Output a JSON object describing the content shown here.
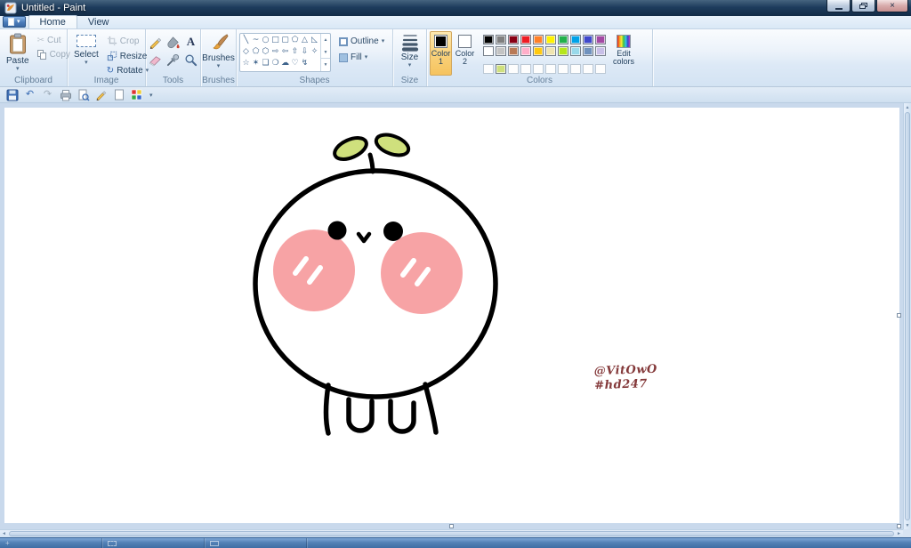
{
  "window": {
    "title": "Untitled - Paint"
  },
  "icons": {
    "dropdown": "▾",
    "scroll_up": "▲",
    "scroll_down": "▼",
    "close": "×",
    "cut": "✂",
    "undo": "↶",
    "redo": "↷",
    "rotate": "↻",
    "text_tool": "A",
    "customize": "▾",
    "scroll_left": "◄",
    "scroll_right": "►",
    "crosshair": "+"
  },
  "ribbon": {
    "tabs": [
      {
        "id": "home",
        "label": "Home",
        "active": true
      },
      {
        "id": "view",
        "label": "View",
        "active": false
      }
    ],
    "clipboard": {
      "group_label": "Clipboard",
      "paste": "Paste",
      "cut": "Cut",
      "copy": "Copy"
    },
    "image": {
      "group_label": "Image",
      "select": "Select",
      "crop": "Crop",
      "resize": "Resize",
      "rotate": "Rotate"
    },
    "tools": {
      "group_label": "Tools",
      "items": [
        "pencil",
        "fill-with-color",
        "text",
        "eraser",
        "color-picker",
        "magnifier"
      ]
    },
    "brushes": {
      "group_label": "Brushes",
      "label": "Brushes"
    },
    "shapes": {
      "group_label": "Shapes",
      "outline_label": "Outline",
      "fill_label": "Fill",
      "items": [
        {
          "name": "line",
          "glyph": "╲"
        },
        {
          "name": "curve",
          "glyph": "~"
        },
        {
          "name": "oval",
          "glyph": "○"
        },
        {
          "name": "rectangle",
          "glyph": "□"
        },
        {
          "name": "rounded-rectangle",
          "glyph": "▢"
        },
        {
          "name": "polygon",
          "glyph": "⬠"
        },
        {
          "name": "triangle",
          "glyph": "△"
        },
        {
          "name": "right-triangle",
          "glyph": "◺"
        },
        {
          "name": "diamond",
          "glyph": "◇"
        },
        {
          "name": "pentagon",
          "glyph": "⬠"
        },
        {
          "name": "hexagon",
          "glyph": "⬡"
        },
        {
          "name": "right-arrow",
          "glyph": "⇨"
        },
        {
          "name": "left-arrow",
          "glyph": "⇦"
        },
        {
          "name": "up-arrow",
          "glyph": "⇧"
        },
        {
          "name": "down-arrow",
          "glyph": "⇩"
        },
        {
          "name": "four-point-star",
          "glyph": "✧"
        },
        {
          "name": "five-point-star",
          "glyph": "☆"
        },
        {
          "name": "six-point-star",
          "glyph": "✶"
        },
        {
          "name": "rounded-callout",
          "glyph": "❑"
        },
        {
          "name": "oval-callout",
          "glyph": "❍"
        },
        {
          "name": "cloud-callout",
          "glyph": "☁"
        },
        {
          "name": "heart",
          "glyph": "♡"
        },
        {
          "name": "lightning",
          "glyph": "↯"
        }
      ]
    },
    "size": {
      "group_label": "Size",
      "label": "Size"
    },
    "colors": {
      "group_label": "Colors",
      "color1_label": "Color",
      "color1_num": "1",
      "color1_value": "#000000",
      "color2_label": "Color",
      "color2_num": "2",
      "color2_value": "#ffffff",
      "edit_line1": "Edit",
      "edit_line2": "colors",
      "palette_rows": [
        [
          "#000000",
          "#7f7f7f",
          "#880015",
          "#ed1c24",
          "#ff7f27",
          "#fff200",
          "#22b14c",
          "#00a2e8",
          "#3f48cc",
          "#a349a4"
        ],
        [
          "#ffffff",
          "#c3c3c3",
          "#b97a57",
          "#ffaec9",
          "#ffc90e",
          "#efe4b0",
          "#b5e61d",
          "#99d9ea",
          "#7092be",
          "#c8bfe7"
        ],
        [
          null,
          "#cfe07d",
          null,
          null,
          null,
          null,
          null,
          null,
          null,
          null
        ]
      ]
    }
  },
  "canvas": {
    "signature_line1": "@VitOwO",
    "signature_line2": "#hd247",
    "signature_color": "#84393a",
    "drawing": {
      "subject": "chibi-sprout-character",
      "outline_color": "#000000",
      "leaf_color": "#cfe07d",
      "cheek_color": "#f7a3a5",
      "body_color": "#ffffff"
    }
  }
}
